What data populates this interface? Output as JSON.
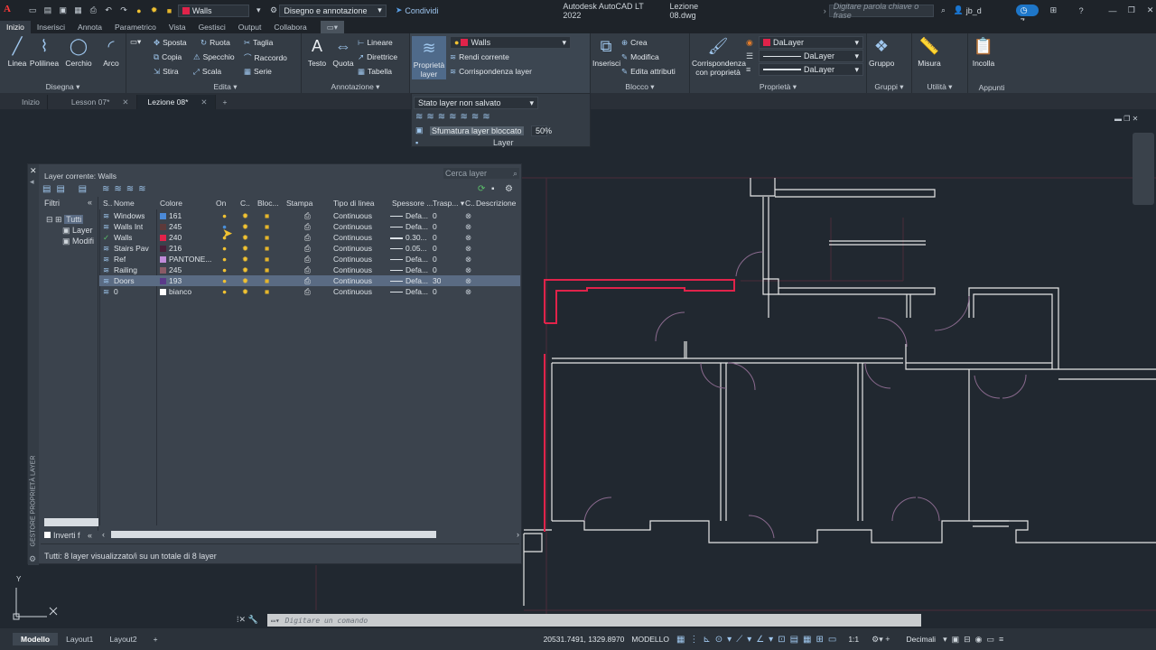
{
  "titlebar": {
    "layer_combo": "Walls",
    "workspace": "Disegno e annotazione",
    "share": "Condividi",
    "app_title": "Autodesk AutoCAD LT 2022",
    "file_title": "Lezione 08.dwg",
    "search_placeholder": "Digitare parola chiave o frase",
    "user": "jb_d",
    "badge_count": "7"
  },
  "ribbon_tabs": [
    "Inizio",
    "Inserisci",
    "Annota",
    "Parametrico",
    "Vista",
    "Gestisci",
    "Output",
    "Collabora"
  ],
  "ribbon": {
    "disegna": {
      "title": "Disegna",
      "tools": [
        "Linea",
        "Polilinea",
        "Cerchio",
        "Arco"
      ]
    },
    "edita": {
      "title": "Edita",
      "tools": [
        "Sposta",
        "Ruota",
        "Taglia",
        "Copia",
        "Specchio",
        "Raccordo",
        "Stira",
        "Scala",
        "Serie"
      ]
    },
    "annotazione": {
      "title": "Annotazione",
      "tools": [
        "Testo",
        "Quota",
        "Lineare",
        "Direttrice",
        "Tabella"
      ]
    },
    "layer": {
      "title": "Layer",
      "prop_label": "Proprietà layer",
      "combo": "Walls",
      "rendi_corrente": "Rendi corrente",
      "corrispondenza": "Corrispondenza layer"
    },
    "blocco": {
      "title": "Blocco",
      "inserisci": "Inserisci",
      "crea": "Crea",
      "modifica": "Modifica",
      "edita_attributi": "Edita attributi"
    },
    "proprieta": {
      "title": "Proprietà",
      "corrispondenza": "Corrispondenza con proprietà",
      "color": "DaLayer",
      "linetype": "DaLayer",
      "lineweight": "DaLayer"
    },
    "gruppi": {
      "title": "Gruppi",
      "label": "Gruppo"
    },
    "utilita": {
      "title": "Utilità",
      "label": "Misura"
    },
    "appunti": {
      "title": "Appunti",
      "label": "Incolla"
    }
  },
  "file_tabs": [
    {
      "label": "Inizio"
    },
    {
      "label": "Lesson 07*"
    },
    {
      "label": "Lezione 08*"
    }
  ],
  "layer_dropdown": {
    "state": "Stato layer non salvato",
    "fade_label": "Sfumatura layer bloccato",
    "fade_value": "50%",
    "title": "Layer"
  },
  "palette": {
    "current_layer": "Layer corrente: Walls",
    "search_placeholder": "Cerca layer",
    "filters_label": "Filtri",
    "tree": [
      "Tutti",
      "Layer",
      "Modifi"
    ],
    "invert_label": "Inverti f",
    "side_title": "GESTORE PROPRIETÀ LAYER",
    "status": "Tutti: 8 layer visualizzato/i su un totale di 8 layer",
    "columns": [
      "S..",
      "Nome",
      "Colore",
      "On",
      "C..",
      "Bloc...",
      "Stampa",
      "Tipo di linea",
      "Spessore ...",
      "Trasp...",
      "C..",
      "Descrizione"
    ],
    "rows": [
      {
        "name": "Windows",
        "color_name": "161",
        "color": "#4b8ad8",
        "linetype": "Continuous",
        "weight": "Defa...",
        "transp": "0"
      },
      {
        "name": "Walls Int",
        "color_name": "245",
        "color": "#5d3a3a",
        "linetype": "Continuous",
        "weight": "Defa...",
        "transp": "0"
      },
      {
        "name": "Walls",
        "color_name": "240",
        "color": "#e0234a",
        "linetype": "Continuous",
        "weight": "0.30...",
        "transp": "0"
      },
      {
        "name": "Stairs Pav",
        "color_name": "216",
        "color": "#4a1f3a",
        "linetype": "Continuous",
        "weight": "0.05...",
        "transp": "0"
      },
      {
        "name": "Ref",
        "color_name": "PANTONE...",
        "color": "#c08bd8",
        "linetype": "Continuous",
        "weight": "Defa...",
        "transp": "0"
      },
      {
        "name": "Railing",
        "color_name": "245",
        "color": "#8a5a66",
        "linetype": "Continuous",
        "weight": "Defa...",
        "transp": "0"
      },
      {
        "name": "Doors",
        "color_name": "193",
        "color": "#5a3a8a",
        "linetype": "Continuous",
        "weight": "Defa...",
        "transp": "30"
      },
      {
        "name": "0",
        "color_name": "bianco",
        "color": "#ffffff",
        "linetype": "Continuous",
        "weight": "Defa...",
        "transp": "0"
      }
    ]
  },
  "command": {
    "placeholder": "Digitare un comando"
  },
  "status": {
    "tabs": [
      "Modello",
      "Layout1",
      "Layout2"
    ],
    "coords": "20531.7491, 1329.8970",
    "mode": "MODELLO",
    "scale": "1:1",
    "units": "Decimali"
  }
}
